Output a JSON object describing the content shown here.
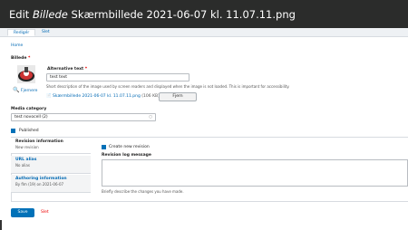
{
  "header": {
    "title_prefix": "Edit",
    "title_italic": "Billede",
    "title_rest": "Skærmbillede 2021-06-07 kl. 11.07.11.png"
  },
  "tabs": [
    {
      "label": "Redigér"
    },
    {
      "label": "Slet"
    }
  ],
  "breadcrumb": "Home",
  "image_field": {
    "label": "Billede",
    "remove_link": "Fjernere",
    "alt_label": "Alternative text",
    "alt_value": "test text",
    "alt_description": "Short description of the image used by screen readers and displayed when the image is not loaded. This is important for accessibility.",
    "file_name": "Skærmbillede 2021-06-07 kl. 11.07.11.png",
    "file_size": "(106 KB)",
    "remove_button": "Fjern"
  },
  "media_category": {
    "label": "Media category",
    "value": "test novocell (2)"
  },
  "published": {
    "label": "Published"
  },
  "vertical_tabs": [
    {
      "title": "Revision information",
      "summary": "New revision"
    },
    {
      "title": "URL alias",
      "summary": "No alias"
    },
    {
      "title": "Authoring information",
      "summary": "By flm (19) on 2021-06-07"
    }
  ],
  "revision": {
    "checkbox_label": "Create new revision",
    "log_label": "Revision log message",
    "log_description": "Briefly describe the changes you have made."
  },
  "actions": {
    "save": "Save",
    "delete": "Slet"
  },
  "colors": {
    "header_bg": "#2b2c2b",
    "link": "#0069b4",
    "primary": "#0071b8",
    "danger": "#e00000"
  }
}
